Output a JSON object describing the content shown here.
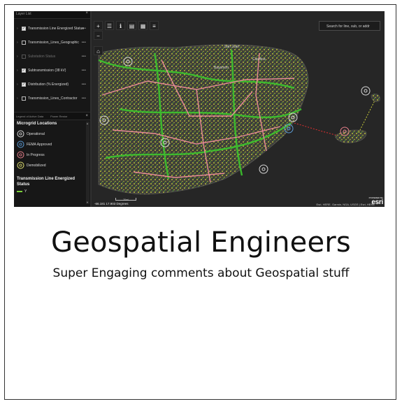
{
  "card": {
    "title": "Geospatial Engineers",
    "subtitle": "Super Engaging comments about Geospatial stuff"
  },
  "panel": {
    "header": "Layer List",
    "close_icon": "close-icon",
    "layers": [
      {
        "label": "Transmission Line Energized Status",
        "checked": true,
        "dim": false
      },
      {
        "label": "Transmission_Lines_Geographic",
        "checked": false,
        "dim": false
      },
      {
        "label": "Substation Status",
        "checked": false,
        "dim": true
      },
      {
        "label": "Subtransmission (38 kV)",
        "checked": true,
        "dim": false
      },
      {
        "label": "Distribution (% Energized)",
        "checked": true,
        "dim": false
      },
      {
        "label": "Transmission_Lines_Contractor",
        "checked": false,
        "dim": false
      }
    ],
    "more_label": "•••",
    "tabs": {
      "legend": "Legend of Active Data",
      "other": "Power Restor"
    },
    "legend": {
      "title": "Microgrid Locations",
      "items": [
        {
          "label": "Operational",
          "color": "#d8d8d8"
        },
        {
          "label": "FEMA Approved",
          "color": "#5b9bd5"
        },
        {
          "label": "In Progress",
          "color": "#e8808c"
        },
        {
          "label": "Demobilized",
          "color": "#e0e070"
        }
      ],
      "section2_title": "Transmission Line Energized Status",
      "section2_first": "Y"
    }
  },
  "map": {
    "search_placeholder": "Search for line, sub, or addr",
    "coords": "-66.181 17.903 Degrees",
    "attribution": "Esri, HERE, Garmin, NGA, USGS | Esri, HERE",
    "powered_by": "POWERED BY",
    "brand": "esri",
    "scale": "20mi",
    "place_labels": [
      "San Juan",
      "Bayamón",
      "Carolina"
    ],
    "colors": {
      "land": "#3d3d3d",
      "sea": "#262626",
      "distribution": "#d9de3a",
      "energized": "#39c02c",
      "transmission": "#e88a96",
      "accent_red": "#e03030"
    },
    "tools": [
      "home-icon",
      "layers-icon",
      "info-icon",
      "basemap-icon",
      "grid-icon",
      "list-icon"
    ]
  }
}
